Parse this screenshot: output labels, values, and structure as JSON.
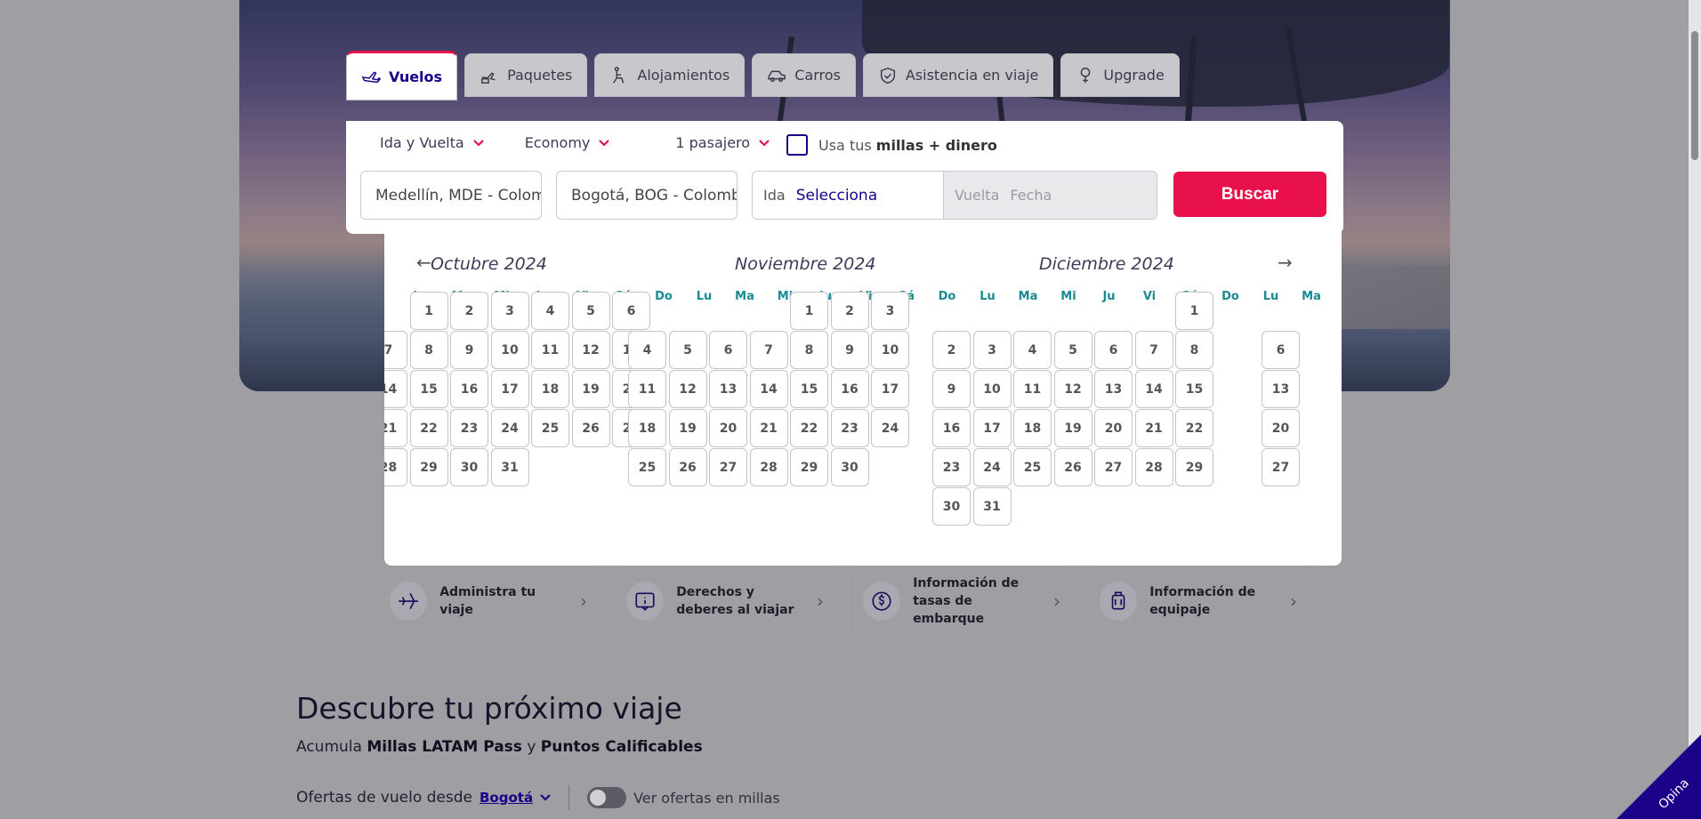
{
  "tabs": [
    {
      "label": "Vuelos",
      "icon": "plane-icon"
    },
    {
      "label": "Paquetes",
      "icon": "package-icon"
    },
    {
      "label": "Alojamientos",
      "icon": "hotel-icon"
    },
    {
      "label": "Carros",
      "icon": "car-icon"
    },
    {
      "label": "Asistencia en viaje",
      "icon": "shield-icon"
    },
    {
      "label": "Upgrade",
      "icon": "upgrade-icon"
    }
  ],
  "options": {
    "trip_type": "Ida y Vuelta",
    "cabin": "Economy",
    "passengers": "1 pasajero",
    "miles_prefix": "Usa tus",
    "miles_bold": "millas + dinero"
  },
  "fields": {
    "origin": "Medellín, MDE - Colombia",
    "destination": "Bogotá, BOG - Colombia",
    "ida_label": "Ida",
    "ida_value": "Selecciona",
    "vuelta_label": "Vuelta",
    "vuelta_value": "Fecha",
    "search_button": "Buscar"
  },
  "calendar": {
    "months": [
      "Octubre 2024",
      "Noviembre 2024",
      "Diciembre 2024"
    ],
    "weekdays": [
      "Lu",
      "Ma",
      "Mi",
      "Ju",
      "Vi",
      "Sá",
      "Do"
    ],
    "prev": "←",
    "next": "→"
  },
  "quick_links": [
    {
      "label": "Administra tu viaje"
    },
    {
      "label": "Derechos y deberes al viajar"
    },
    {
      "label": "Información de tasas de embarque"
    },
    {
      "label": "Información de equipaje"
    }
  ],
  "discover": {
    "title": "Descubre tu próximo viaje",
    "sub_prefix": "Acumula",
    "sub_b1": "Millas LATAM Pass",
    "sub_mid": "y",
    "sub_b2": "Puntos Calificables",
    "offers_label": "Ofertas de vuelo desde",
    "offers_city": "Bogotá",
    "miles_toggle": "Ver ofertas en millas"
  },
  "feedback": "Opina",
  "colors": {
    "brand": "#1b0088",
    "accent": "#e8114b",
    "weekday": "#1a8a93"
  }
}
